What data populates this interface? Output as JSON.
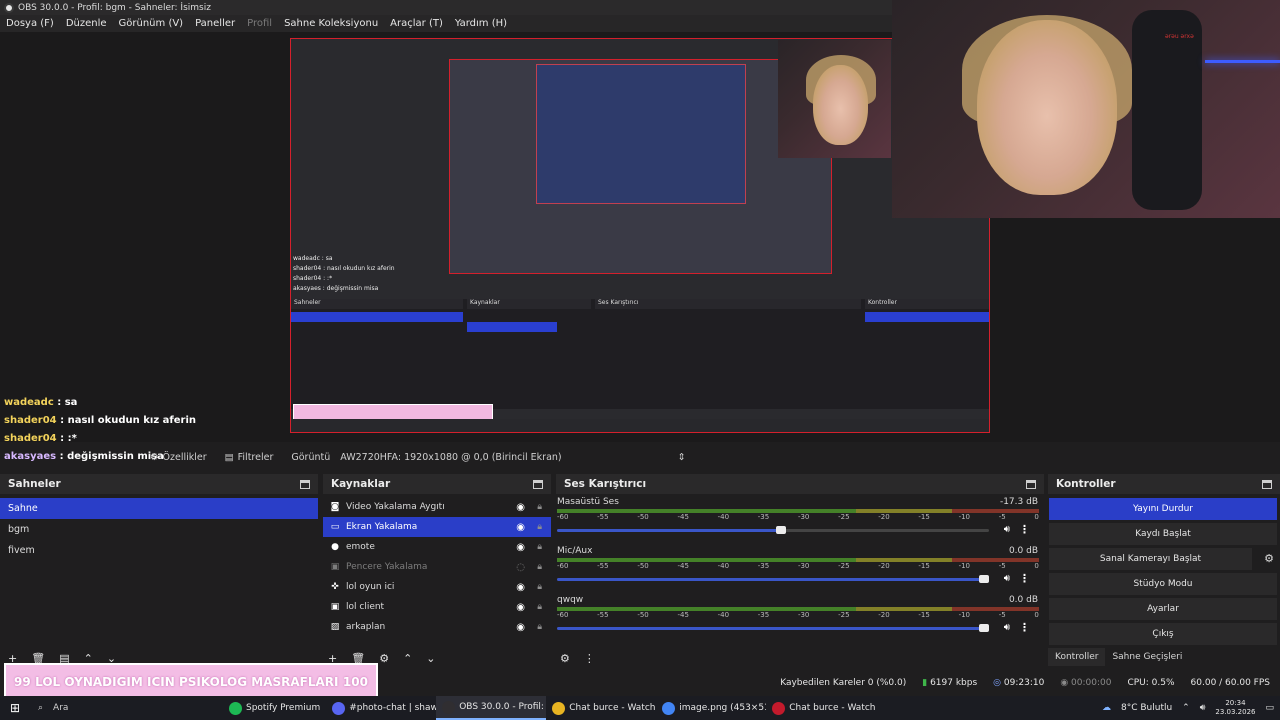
{
  "window": {
    "title": "OBS 30.0.0 - Profil: bgm - Sahneler: İsimsiz"
  },
  "menu": [
    {
      "label": "Dosya (F)",
      "enabled": true
    },
    {
      "label": "Düzenle",
      "enabled": true
    },
    {
      "label": "Görünüm (V)",
      "enabled": true
    },
    {
      "label": "Paneller",
      "enabled": true
    },
    {
      "label": "Profil",
      "enabled": false
    },
    {
      "label": "Sahne Koleksiyonu",
      "enabled": true
    },
    {
      "label": "Araçlar (T)",
      "enabled": true
    },
    {
      "label": "Yardım (H)",
      "enabled": true
    }
  ],
  "chat": [
    {
      "user": "wadeadc",
      "msg": "sa"
    },
    {
      "user": "shader04",
      "msg": "nasıl okudun kız aferin"
    },
    {
      "user": "shader04",
      "msg": ":*"
    },
    {
      "user": "akasyaes",
      "msg": "değişmissin misa"
    }
  ],
  "preview_bar": {
    "properties": "Özellikler",
    "filters": "Filtreler",
    "display_label": "Görüntü",
    "display_value": "AW2720HFA: 1920x1080 @ 0,0 (Birincil Ekran)"
  },
  "scenes": {
    "title": "Sahneler",
    "items": [
      "Sahne",
      "bgm",
      "fivem"
    ]
  },
  "sources": {
    "title": "Kaynaklar",
    "items": [
      {
        "name": "Video Yakalama Aygıtı",
        "icon": "camera-icon"
      },
      {
        "name": "Ekran Yakalama",
        "icon": "monitor-icon"
      },
      {
        "name": "emote",
        "icon": "brush-icon"
      },
      {
        "name": "Pencere Yakalama",
        "icon": "window-icon"
      },
      {
        "name": "lol oyun ici",
        "icon": "gamepad-icon"
      },
      {
        "name": "lol client",
        "icon": "window-icon"
      },
      {
        "name": "arkaplan",
        "icon": "image-icon"
      }
    ]
  },
  "mixer": {
    "title": "Ses Karıştırıcı",
    "scale": [
      "-60",
      "-55",
      "-50",
      "-45",
      "-40",
      "-35",
      "-30",
      "-25",
      "-20",
      "-15",
      "-10",
      "-5",
      "0"
    ],
    "channels": [
      {
        "name": "Masaüstü Ses",
        "db": "-17.3 dB",
        "level": 0.52
      },
      {
        "name": "Mic/Aux",
        "db": "0.0 dB",
        "level": 1.0
      },
      {
        "name": "qwqw",
        "db": "0.0 dB",
        "level": 1.0
      }
    ]
  },
  "controls": {
    "title": "Kontroller",
    "stop_stream": "Yayını Durdur",
    "start_record": "Kaydı Başlat",
    "virtual_cam": "Sanal Kamerayı Başlat",
    "studio_mode": "Stüdyo Modu",
    "settings": "Ayarlar",
    "exit": "Çıkış"
  },
  "dock_tabs": [
    "Kontroller",
    "Sahne Geçişleri"
  ],
  "status": {
    "dropped": "Kaybedilen Kareler 0 (%0.0)",
    "kbps": "6197 kbps",
    "stream_time": "09:23:10",
    "record_time": "00:00:00",
    "cpu": "CPU: 0.5%",
    "fps": "60.00 / 60.00 FPS"
  },
  "overlay": {
    "left_num": "99",
    "text": "LOL OYNADIGIM ICIN PSIKOLOG MASRAFLARI",
    "right_num": "100"
  },
  "taskbar": {
    "search": "Ara",
    "apps": [
      {
        "label": "Spotify Premium",
        "color": "#1db954",
        "active": false
      },
      {
        "label": "#photo-chat | shaw...",
        "color": "#5865f2",
        "active": false
      },
      {
        "label": "OBS 30.0.0 - Profil: ...",
        "color": "#302e31",
        "active": true
      },
      {
        "label": "Chat burce - Watch...",
        "color": "#e8b422",
        "active": false
      },
      {
        "label": "image.png (453×51...",
        "color": "#4285f4",
        "active": false
      },
      {
        "label": "Chat burce - Watch...",
        "color": "#c31a2c",
        "active": false
      }
    ],
    "weather": "8°C  Bulutlu",
    "time": "20:34",
    "date": "23.03.2026"
  },
  "webcam_label": "ərəu ərxə",
  "colors": {
    "accent": "#2a3ec8",
    "recording_red": "#d4202c",
    "overlay_pink": "#f3bde5"
  }
}
